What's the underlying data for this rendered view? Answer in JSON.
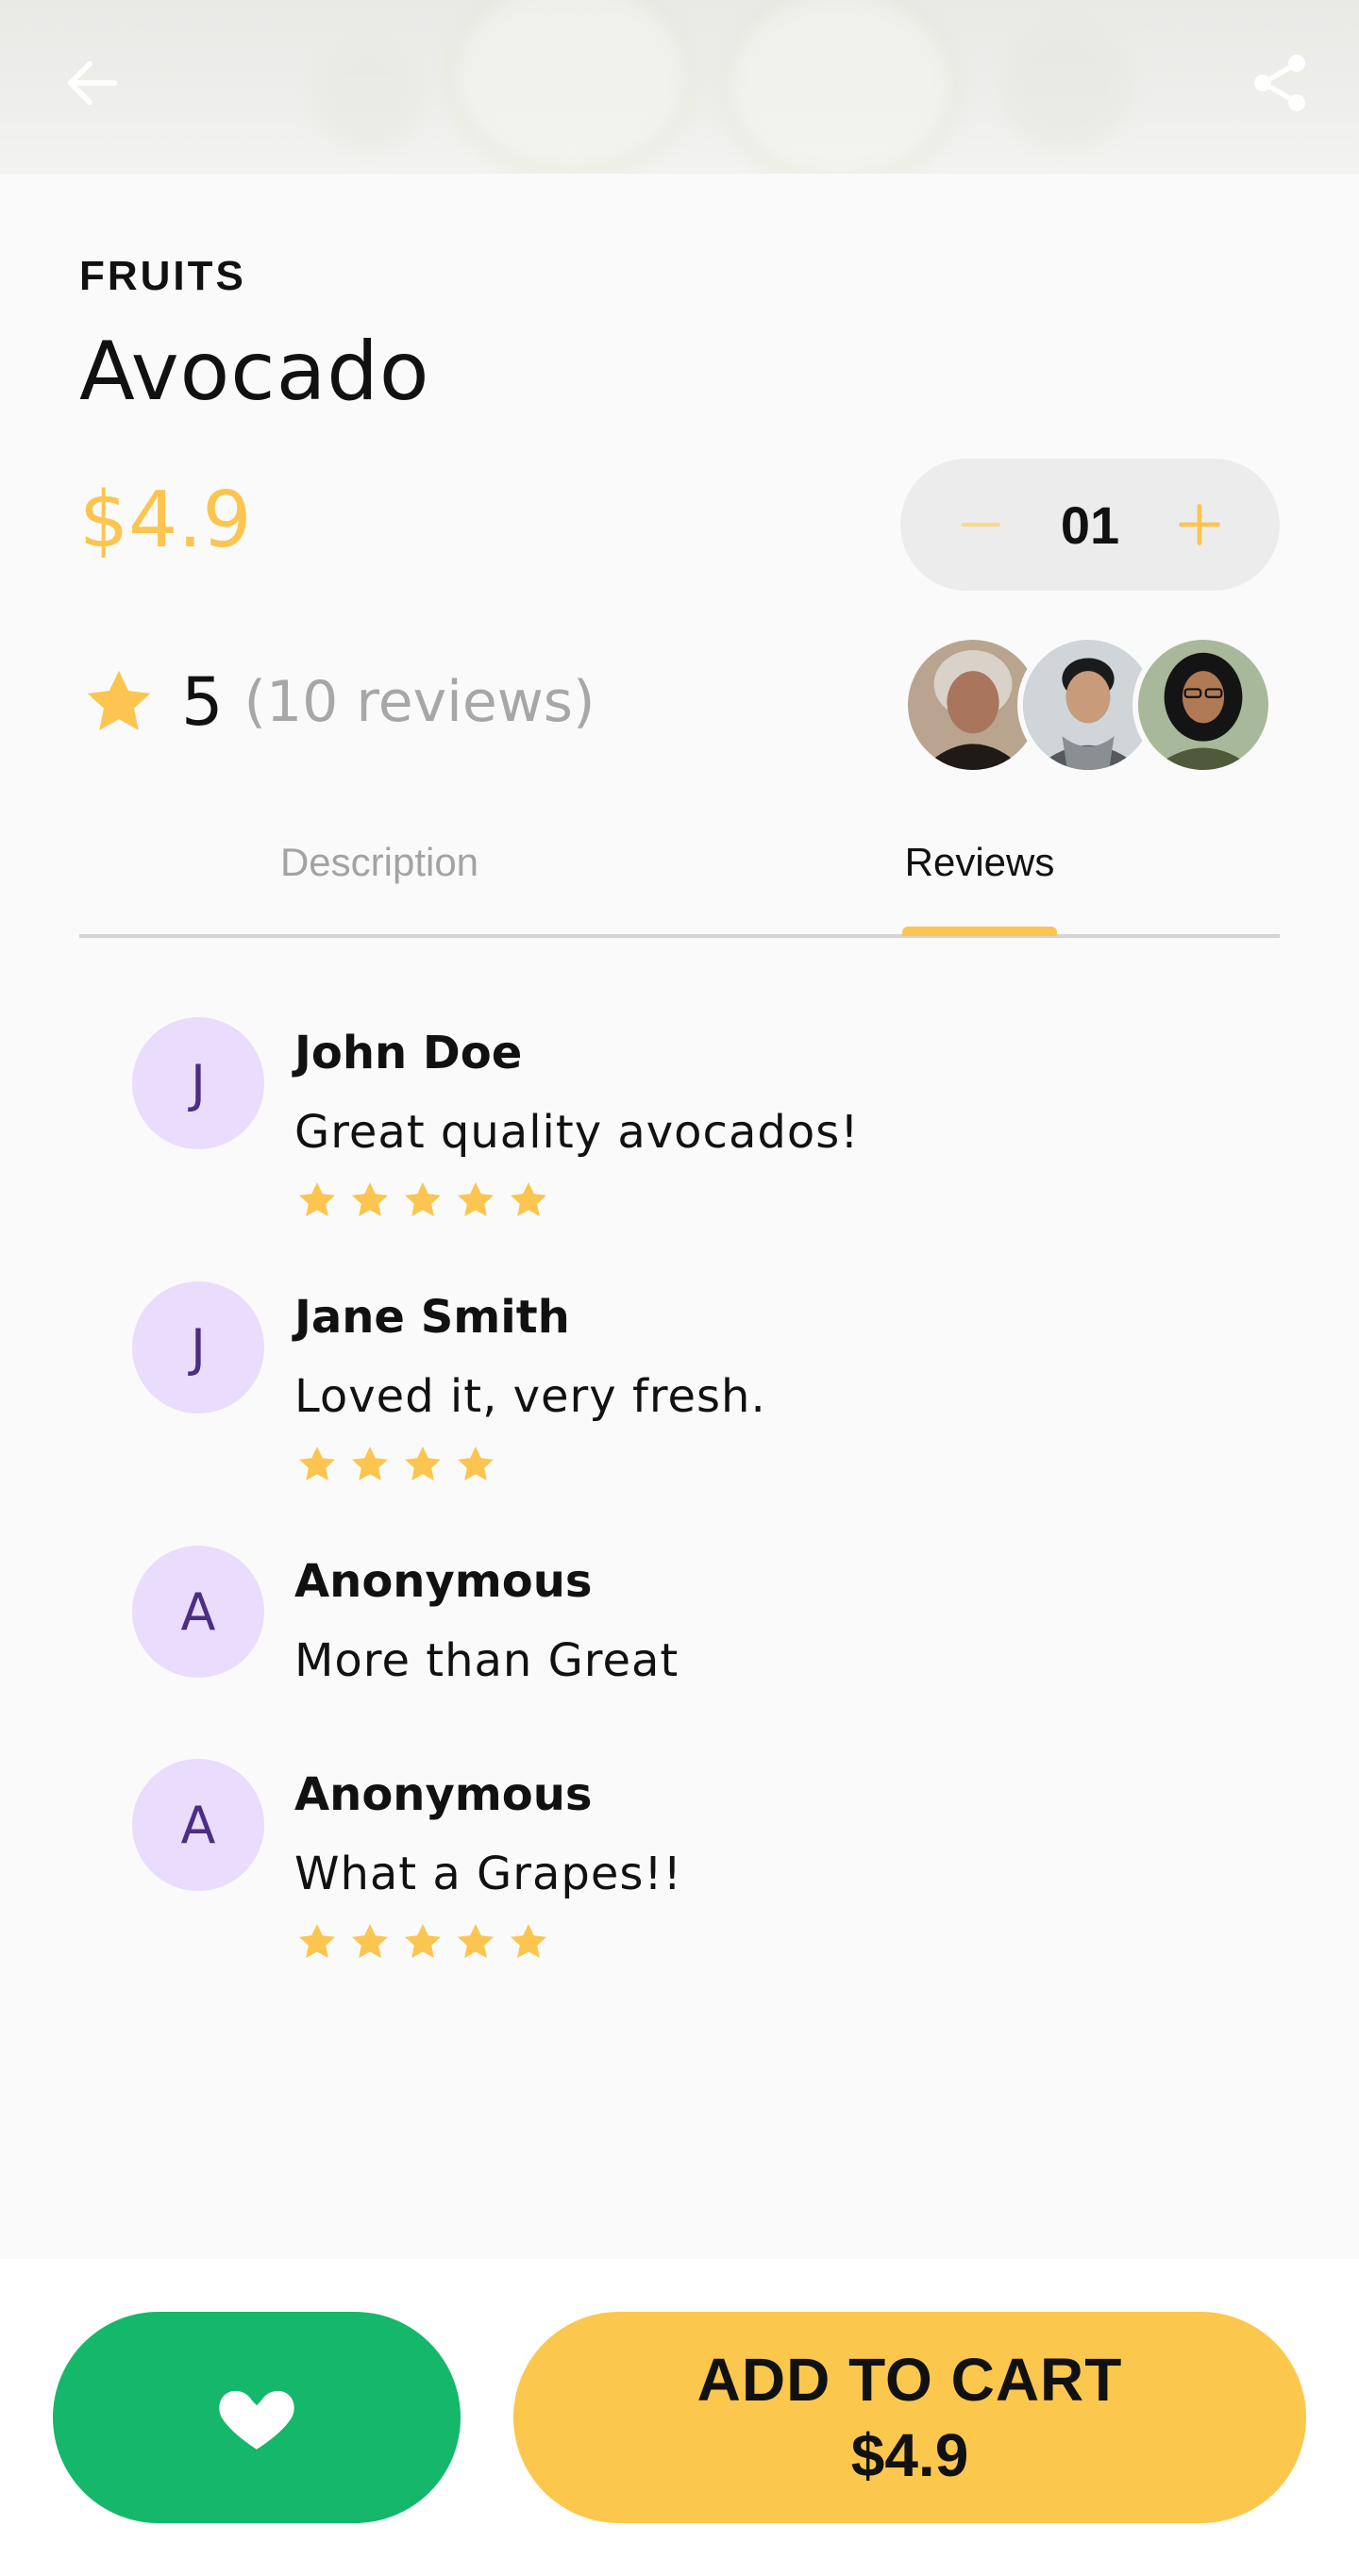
{
  "header": {
    "back_icon": "arrow-left-icon",
    "share_icon": "share-icon"
  },
  "product": {
    "category": "FRUITS",
    "name": "Avocado",
    "price": "$4.9",
    "quantity": "01",
    "rating": "5",
    "reviews_count_label": "(10 reviews)"
  },
  "tabs": [
    {
      "label": "Description",
      "active": false
    },
    {
      "label": "Reviews",
      "active": true
    }
  ],
  "reviews": [
    {
      "initial": "J",
      "name": "John Doe",
      "text": "Great quality avocados!",
      "stars": 5
    },
    {
      "initial": "J",
      "name": "Jane Smith",
      "text": "Loved it, very fresh.",
      "stars": 4
    },
    {
      "initial": "A",
      "name": "Anonymous",
      "text": "More than Great",
      "stars": 0
    },
    {
      "initial": "A",
      "name": "Anonymous",
      "text": "What a Grapes!!",
      "stars": 5
    }
  ],
  "bottom": {
    "favorite_icon": "heart-icon",
    "cart_line1": "ADD TO CART",
    "cart_line2": "$4.9"
  },
  "colors": {
    "accent": "#fbc54f",
    "green": "#15b76a",
    "avatar_bg": "#eadcfc",
    "avatar_text": "#4b2e83"
  }
}
